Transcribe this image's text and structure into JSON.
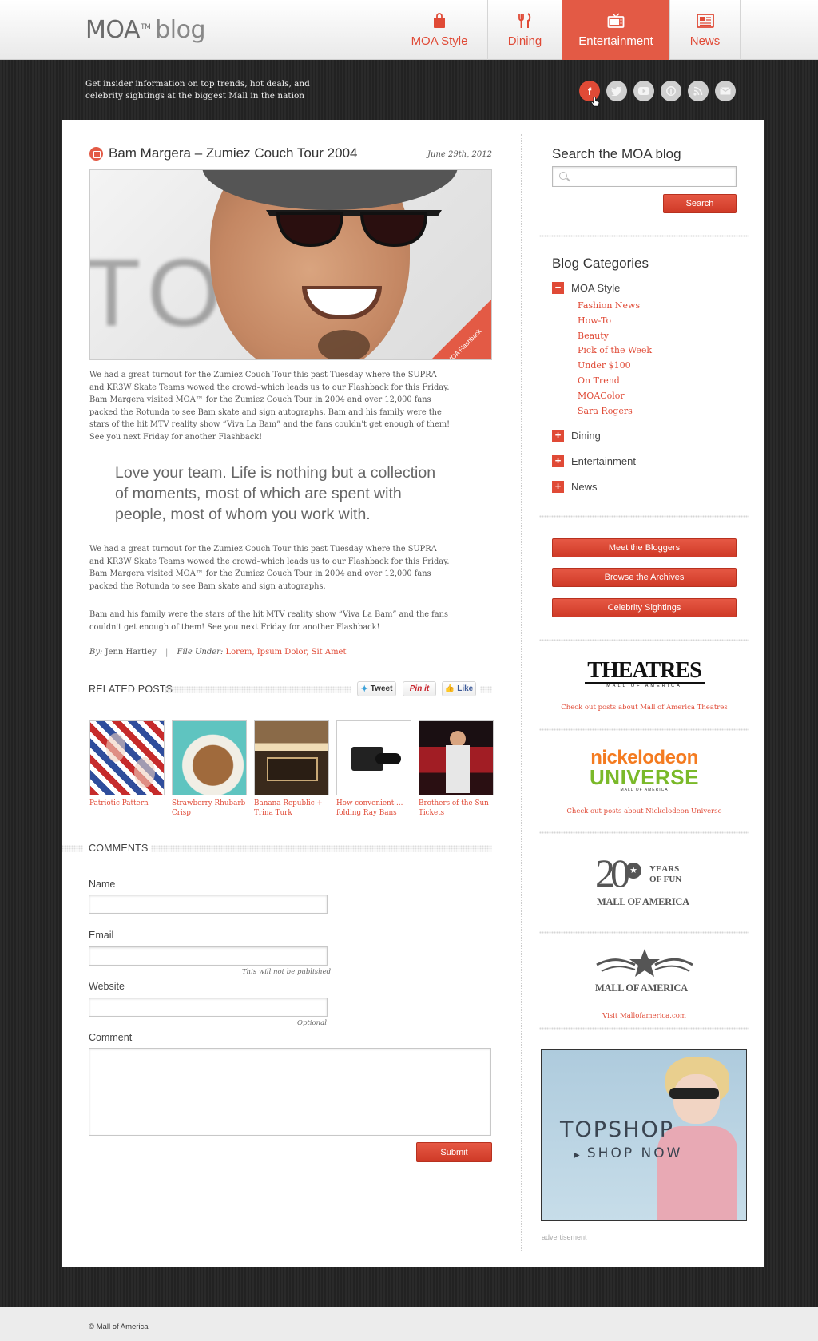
{
  "header": {
    "logo_moa": "MOA",
    "logo_tm": "TM",
    "logo_blog": "blog",
    "nav": [
      {
        "label": "MOA Style",
        "icon": "shopping-bag-icon"
      },
      {
        "label": "Dining",
        "icon": "fork-knife-icon"
      },
      {
        "label": "Entertainment",
        "icon": "tv-icon"
      },
      {
        "label": "News",
        "icon": "newspaper-icon"
      }
    ],
    "active_nav": "Entertainment",
    "tagline": "Get insider information on top trends, hot deals, and celebrity sightings at the biggest Mall in the nation",
    "social": [
      "facebook-icon",
      "twitter-icon",
      "youtube-icon",
      "pinterest-icon",
      "rss-icon",
      "email-icon"
    ]
  },
  "post": {
    "title": "Bam Margera – Zumiez Couch Tour 2004",
    "date": "June 29th, 2012",
    "ribbon": "MOA Flashback",
    "para1": "We had a great turnout for the Zumiez Couch Tour this past Tuesday where the SUPRA and KR3W Skate Teams wowed the crowd–which leads us to our Flashback for this Friday. Bam Margera visited MOA™ for the Zumiez Couch Tour in 2004 and over 12,000 fans packed the Rotunda to see Bam skate and sign autographs. Bam and his family were the stars of the hit MTV reality show “Viva La Bam” and the fans couldn't get enough of them! See you next Friday for another Flashback!",
    "quote": "Love your team. Life is nothing but a collection of moments, most of which are spent with people, most of whom you work with.",
    "para2": "We had a great turnout for the Zumiez Couch Tour this past Tuesday where the SUPRA and KR3W Skate Teams wowed the crowd–which leads us to our Flashback for this Friday. Bam Margera visited MOA™ for the Zumiez Couch Tour in 2004 and over 12,000 fans packed the Rotunda to see Bam skate and sign autographs.",
    "para3": "Bam and his family were the stars of the hit MTV reality show “Viva La Bam” and the fans couldn't get enough of them!  See you next Friday for another Flashback!",
    "by_label": "By:",
    "author": "Jenn Hartley",
    "file_under_label": "File Under:",
    "file_under": "Lorem, Ipsum Dolor, Sit Amet"
  },
  "related": {
    "heading": "RELATED POSTS",
    "share": {
      "tweet": "Tweet",
      "pin": "Pin it",
      "like": "Like"
    },
    "items": [
      {
        "caption": "Patriotic Pattern"
      },
      {
        "caption": "Strawberry Rhubarb Crisp"
      },
      {
        "caption": "Banana Republic + Trina Turk"
      },
      {
        "caption": "How convenient ... folding Ray Bans"
      },
      {
        "caption": "Brothers of the Sun Tickets"
      }
    ]
  },
  "comments": {
    "heading": "COMMENTS",
    "name_label": "Name",
    "email_label": "Email",
    "email_note": "This will not be published",
    "website_label": "Website",
    "website_note": "Optional",
    "comment_label": "Comment",
    "submit": "Submit"
  },
  "sidebar": {
    "search_title": "Search the MOA blog",
    "search_button": "Search",
    "categories_title": "Blog Categories",
    "categories": [
      {
        "label": "MOA Style",
        "expanded": true,
        "toggle": "−"
      },
      {
        "label": "Dining",
        "expanded": false,
        "toggle": "+"
      },
      {
        "label": "Entertainment",
        "expanded": false,
        "toggle": "+"
      },
      {
        "label": "News",
        "expanded": false,
        "toggle": "+"
      }
    ],
    "subcategories": [
      "Fashion News",
      "How-To",
      "Beauty",
      "Pick of the Week",
      "Under $100",
      "On Trend",
      "MOAColor",
      "Sara Rogers"
    ],
    "buttons": [
      "Meet the Bloggers",
      "Browse the Archives",
      "Celebrity Sightings"
    ],
    "partners": [
      {
        "logo_text": "THEATRES",
        "logo_sub": "MALL OF AMERICA",
        "caption": "Check out posts about Mall of America Theatres"
      },
      {
        "logo_text": "nickelodeon",
        "logo_sub": "UNIVERSE",
        "logo_sub2": "MALL OF AMERICA",
        "caption": "Check out posts about Nickelodeon Universe"
      },
      {
        "logo_text": "20",
        "logo_sub": "YEARS OF FUN",
        "logo_sub2": "MALL OF AMERICA"
      },
      {
        "logo_text": "MALL OF AMERICA",
        "caption": "Visit Mallofamerica.com"
      }
    ],
    "ad": {
      "brand": "TOPSHOP",
      "cta": "SHOP NOW",
      "label": "advertisement"
    }
  },
  "footer": {
    "copyright": "© Mall of America"
  },
  "colors": {
    "accent": "#e04a36",
    "panel": "#ffffff",
    "background": "#262626"
  }
}
